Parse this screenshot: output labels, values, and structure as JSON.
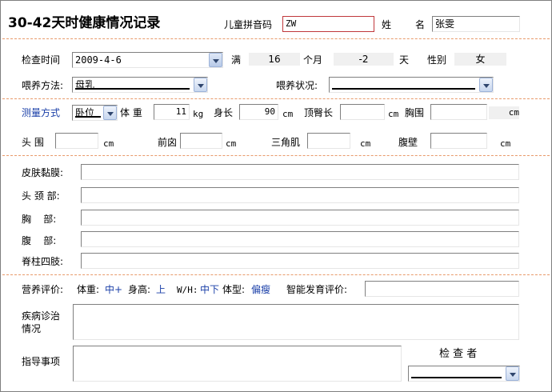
{
  "header": {
    "title": "30-42天时健康情况记录",
    "pinyin_label": "儿童拼音码",
    "pinyin_value": "ZW",
    "surname_label": "姓",
    "givenname_label": "名",
    "name_value": "张雯"
  },
  "exam": {
    "time_label": "检查时间",
    "time_value": "2009-4-6",
    "full_label": "满",
    "months_value": "16",
    "months_unit": "个月",
    "days_value": "-2",
    "days_unit": "天",
    "sex_label": "性别",
    "sex_value": "女",
    "feeding_method_label": "喂养方法:",
    "feeding_method_value": "母乳",
    "feeding_status_label": "喂养状况:",
    "feeding_status_value": ""
  },
  "measure": {
    "method_label": "测量方式",
    "method_value": "卧位",
    "weight_label": "体 重",
    "weight_value": "11",
    "weight_unit": "kg",
    "height_label": "身长",
    "height_value": "90",
    "height_unit": "cm",
    "crown_label": "顶臀长",
    "crown_value": "",
    "crown_unit": "cm",
    "chest_label": "胸围",
    "chest_value": "",
    "chest_unit": "cm",
    "head_label": "头 围",
    "head_value": "",
    "head_unit": "cm",
    "fontanel_label": "前囟",
    "fontanel_value": "",
    "fontanel_unit": "cm",
    "triceps_label": "三角肌",
    "triceps_value": "",
    "triceps_unit": "cm",
    "abdomen_wall_label": "腹壁",
    "abdomen_wall_value": "",
    "abdomen_wall_unit": "cm"
  },
  "physical": {
    "skin_label": "皮肤黏膜:",
    "skin_value": "",
    "headneck_label": "头 颈 部:",
    "headneck_value": "",
    "chest_label": "胸    部:",
    "chest_value": "",
    "abdomen_label": "腹    部:",
    "abdomen_value": "",
    "spine_label": "脊柱四肢:",
    "spine_value": ""
  },
  "evaluation": {
    "nutrition_label": "营养评价:",
    "weight_label": "体重:",
    "weight_value": "中+",
    "height_label": "身高:",
    "height_value": "上",
    "wh_label": "W/H:",
    "wh_value": "中下",
    "body_label": "体型:",
    "body_value": "偏瘦",
    "intel_label": "智能发育评价:",
    "intel_value": "",
    "disease_label": "疾病诊治情况",
    "disease_value": "",
    "guide_label": "指导事项",
    "guide_value": "",
    "examiner_label": "检 查 者",
    "examiner_value": ""
  },
  "colors": {
    "divider": "#e89a6a",
    "accent_text": "#1a3fa8",
    "pinyin_border": "#c0383c"
  }
}
